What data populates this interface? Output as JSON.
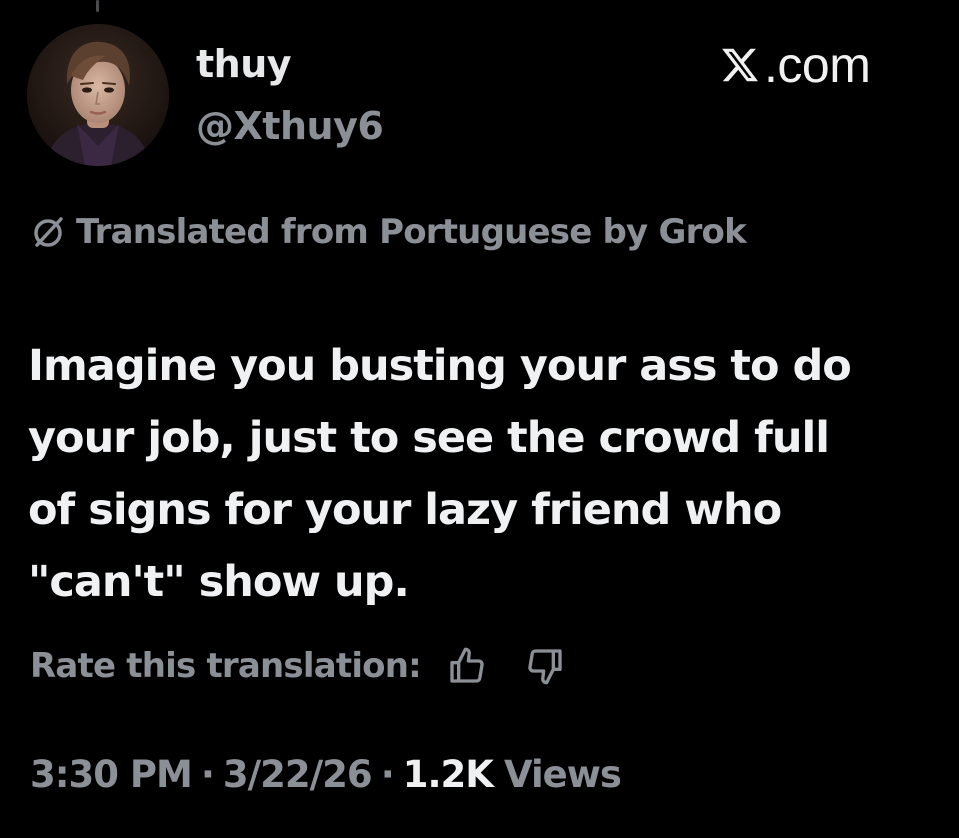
{
  "author": {
    "display_name": "thuy",
    "handle": "@Xthuy6"
  },
  "brand": {
    "label": ".com"
  },
  "translation": {
    "notice": "Translated from Portuguese by Grok",
    "rate_label": "Rate this translation:"
  },
  "tweet": {
    "lines": [
      "Imagine you busting your ass to do",
      "your job, just to see the crowd full",
      "of signs for your lazy friend who",
      "\"can't\" show up."
    ]
  },
  "meta": {
    "time": "3:30 PM",
    "separator": "·",
    "date": "3/22/26",
    "views_count": "1.2K",
    "views_label": "Views"
  },
  "icons": {
    "globe": "globe-slash-icon",
    "thumbs_up": "thumbs-up-icon",
    "thumbs_down": "thumbs-down-icon",
    "brand": "x-logo-icon"
  },
  "colors": {
    "background": "#000000",
    "primary_text": "#e7e9ea",
    "secondary_text": "#8b9097"
  }
}
